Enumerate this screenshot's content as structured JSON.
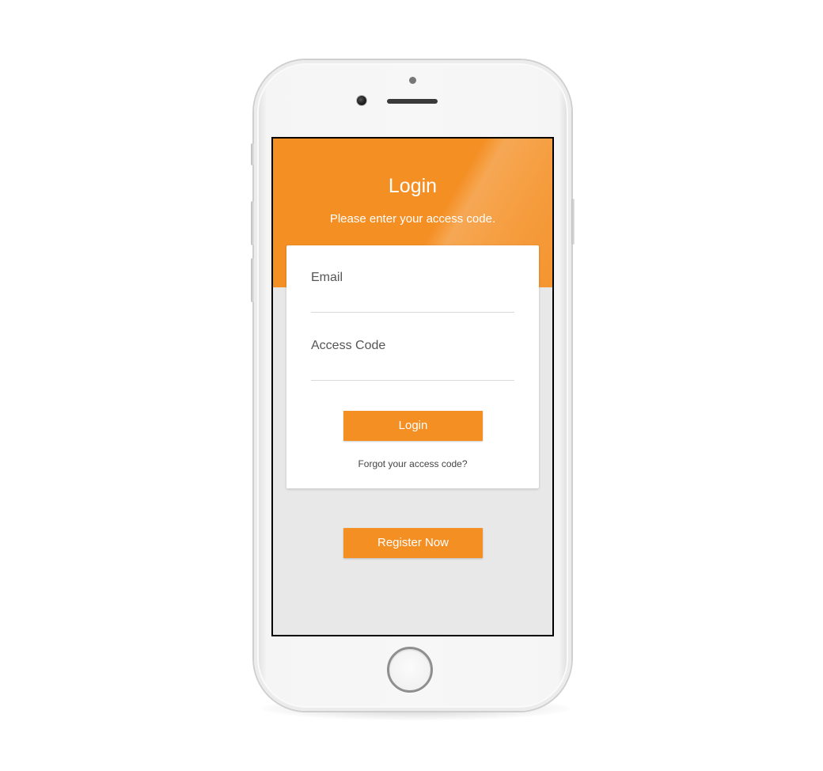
{
  "header": {
    "title": "Login",
    "subtitle": "Please enter your access code."
  },
  "form": {
    "email_label": "Email",
    "email_value": "",
    "access_code_label": "Access Code",
    "access_code_value": "",
    "login_button_label": "Login",
    "forgot_link_label": "Forgot your access code?"
  },
  "register": {
    "button_label": "Register Now"
  },
  "colors": {
    "accent": "#f48f24",
    "screen_background": "#e8e8e8",
    "card_background": "#ffffff"
  },
  "device": {
    "icons": [
      "camera-icon",
      "sensor-icon",
      "speaker-icon",
      "home-button-icon"
    ]
  }
}
